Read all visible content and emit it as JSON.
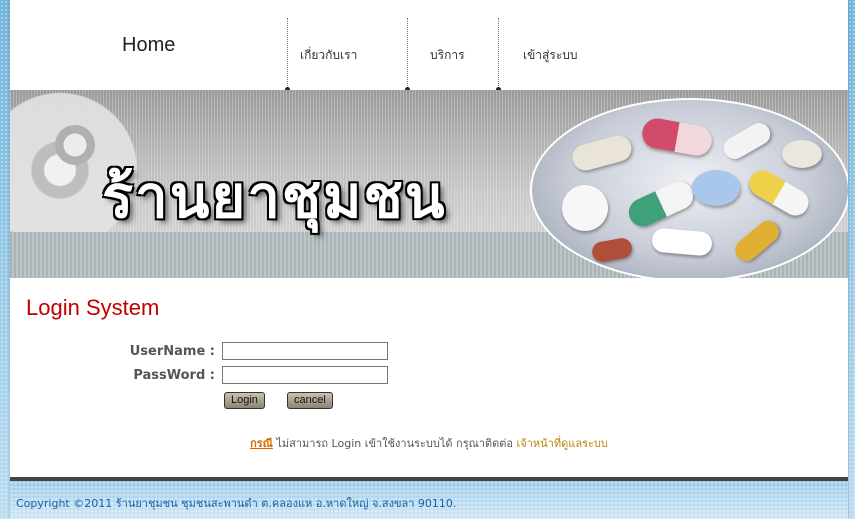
{
  "nav": {
    "home_label": "Home",
    "items": [
      {
        "label": "เกี่ยวกับเรา"
      },
      {
        "label": "บริการ"
      },
      {
        "label": "เข้าสู่ระบบ"
      }
    ]
  },
  "banner": {
    "shop_name": "ร้านยาชุมชน"
  },
  "login": {
    "title": "Login System",
    "username_label": "UserName :",
    "username_value": "",
    "password_label": "PassWord :",
    "password_value": "",
    "login_button": "Login",
    "cancel_button": "cancel"
  },
  "note": {
    "case_link": "กรณี",
    "message": " ไม่สามารถ Login เข้าใช้งานระบบได้ กรุณาติดต่อ ",
    "contact_link": "เจ้าหน้าที่ดูแลระบบ"
  },
  "footer": {
    "copyright": "Copyright ©2011 ร้านยาชุมชน ชุมชนสะพานดำ ต.คลองแห อ.หาดใหญ่ จ.สงขลา 90110."
  },
  "colors": {
    "title_red": "#c00000",
    "link_orange": "#d46a00",
    "footer_blue": "#1b5fa8"
  }
}
